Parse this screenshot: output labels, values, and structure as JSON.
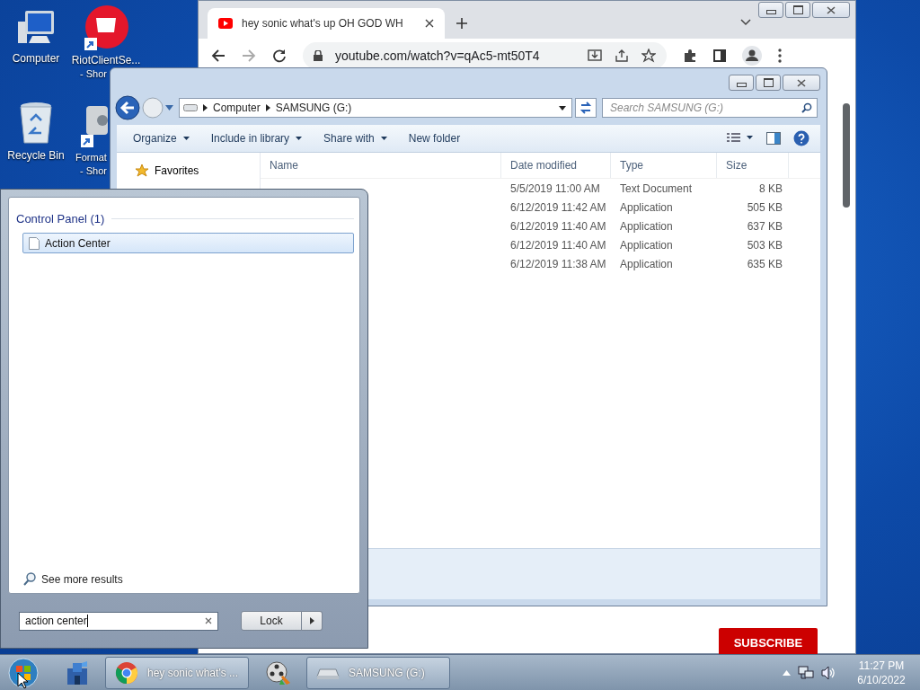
{
  "desktop_icons": [
    {
      "kind": "computer",
      "lines": [
        "Computer"
      ]
    },
    {
      "kind": "riot",
      "lines": [
        "RiotClientSe...",
        "- Shor"
      ]
    },
    {
      "kind": "recycle",
      "lines": [
        "Recycle Bin"
      ]
    },
    {
      "kind": "format",
      "lines": [
        "Format",
        "- Shor"
      ]
    }
  ],
  "browser": {
    "tab_title": "hey sonic what's up OH GOD WH",
    "url": "youtube.com/watch?v=qAc5-mt50T4",
    "subscribe": "SUBSCRIBE"
  },
  "explorer": {
    "breadcrumb": [
      "Computer",
      "SAMSUNG (G:)"
    ],
    "search_placeholder": "Search SAMSUNG (G:)",
    "toolbar": [
      {
        "label": "Organize",
        "menu": true
      },
      {
        "label": "Include in library",
        "menu": true
      },
      {
        "label": "Share with",
        "menu": true
      },
      {
        "label": "New folder",
        "menu": false
      }
    ],
    "sidebar": [
      "Favorites"
    ],
    "columns": [
      "Name",
      "Date modified",
      "Type",
      "Size"
    ],
    "rows": [
      {
        "date": "5/5/2019 11:00 AM",
        "type": "Text Document",
        "size": "8 KB"
      },
      {
        "date": "6/12/2019 11:42 AM",
        "type": "Application",
        "size": "505 KB"
      },
      {
        "date": "6/12/2019 11:40 AM",
        "type": "Application",
        "size": "637 KB"
      },
      {
        "date": "6/12/2019 11:40 AM",
        "type": "Application",
        "size": "503 KB"
      },
      {
        "date": "6/12/2019 11:38 AM",
        "type": "Application",
        "size": "635 KB"
      }
    ]
  },
  "start_menu": {
    "group": "Control Panel (1)",
    "results": [
      {
        "label": "Action Center",
        "selected": true
      }
    ],
    "see_more": "See more results",
    "search_value": "action center",
    "power_button": "Lock"
  },
  "taskbar": {
    "items": [
      {
        "kind": "start"
      },
      {
        "kind": "pinned"
      },
      {
        "kind": "chrome",
        "label": "hey sonic what's ..."
      },
      {
        "kind": "movie"
      },
      {
        "kind": "drive",
        "label": "SAMSUNG (G:)"
      }
    ],
    "time": "11:27 PM",
    "date": "6/10/2022"
  }
}
